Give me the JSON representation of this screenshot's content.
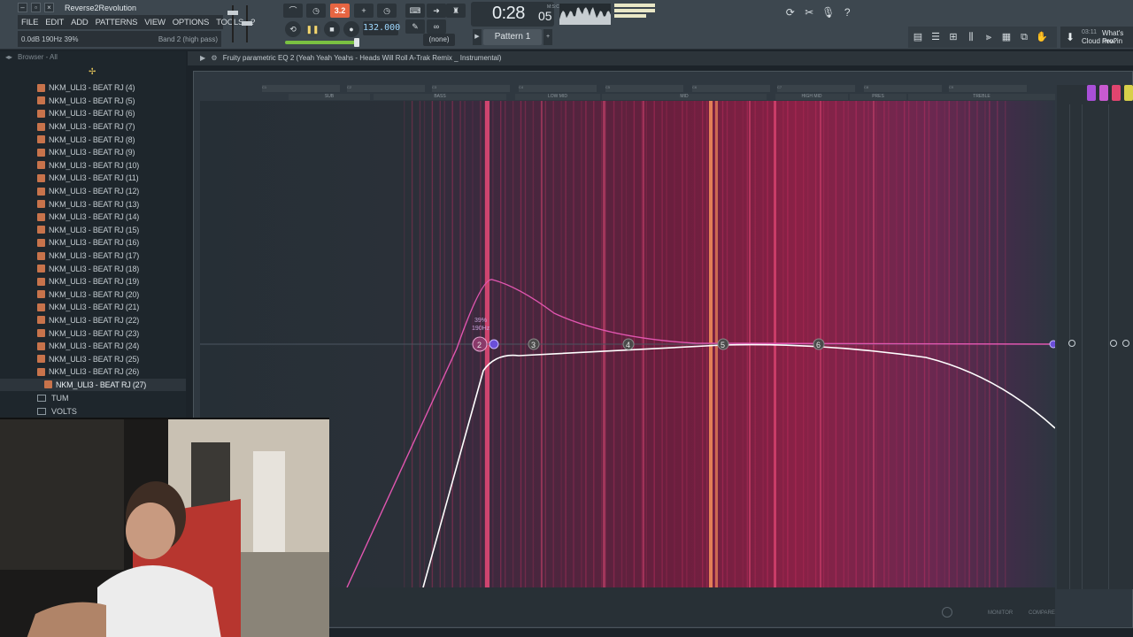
{
  "window": {
    "title": "Reverse2Revolution",
    "menu": [
      "FILE",
      "EDIT",
      "ADD",
      "PATTERNS",
      "VIEW",
      "OPTIONS",
      "TOOLS",
      "?"
    ],
    "hint_left": "0.0dB  190Hz  39%",
    "hint_right": "Band 2 (high pass)"
  },
  "transport": {
    "countdown_label": "3.2",
    "tempo": "132.000",
    "time": "0:28",
    "time_frames": "05",
    "time_unit_label": "M:S:CS",
    "pattern": "Pattern 1",
    "snap": "(none)"
  },
  "news": {
    "date": "03:11",
    "headline": "What's new in",
    "text": "Cloud Pro?"
  },
  "browser": {
    "header": "Browser - All",
    "items": [
      "NKM_ULI3 - BEAT RJ (4)",
      "NKM_ULI3 - BEAT RJ (5)",
      "NKM_ULI3 - BEAT RJ (6)",
      "NKM_ULI3 - BEAT RJ (7)",
      "NKM_ULI3 - BEAT RJ (8)",
      "NKM_ULI3 - BEAT RJ (9)",
      "NKM_ULI3 - BEAT RJ (10)",
      "NKM_ULI3 - BEAT RJ (11)",
      "NKM_ULI3 - BEAT RJ (12)",
      "NKM_ULI3 - BEAT RJ (13)",
      "NKM_ULI3 - BEAT RJ (14)",
      "NKM_ULI3 - BEAT RJ (15)",
      "NKM_ULI3 - BEAT RJ (16)",
      "NKM_ULI3 - BEAT RJ (17)",
      "NKM_ULI3 - BEAT RJ (18)",
      "NKM_ULI3 - BEAT RJ (19)",
      "NKM_ULI3 - BEAT RJ (20)",
      "NKM_ULI3 - BEAT RJ (21)",
      "NKM_ULI3 - BEAT RJ (22)",
      "NKM_ULI3 - BEAT RJ (23)",
      "NKM_ULI3 - BEAT RJ (24)",
      "NKM_ULI3 - BEAT RJ (25)",
      "NKM_ULI3 - BEAT RJ (26)"
    ],
    "selected": "NKM_ULI3 - BEAT RJ (27)",
    "folders": [
      "TUM",
      "VOLTS"
    ]
  },
  "plugin": {
    "title": "Fruity parametric EQ 2 (Yeah Yeah Yeahs - Heads Will Roll A-Trak Remix _ Instrumental)",
    "band_names": [
      "SUB",
      "BASS",
      "LOW MID",
      "MID",
      "HIGH MID",
      "PRES",
      "TREBLE"
    ],
    "octaves": [
      "C1",
      "C2",
      "C3",
      "C4",
      "C5",
      "C6",
      "C7",
      "C8",
      "C9"
    ],
    "selected_band_readout": {
      "width": "39%",
      "freq": "190Hz"
    },
    "nodes": [
      "2",
      "3",
      "4",
      "5",
      "6"
    ],
    "footer_labels": {
      "monitor": "MONITOR",
      "compare": "COMPARE"
    },
    "colors": {
      "spectrum": "#e0336b",
      "curve_pink": "#e056b0",
      "curve_white": "#ffffff",
      "band_swatches": [
        "#a94fd8",
        "#c85ad0",
        "#e0456f",
        "#d8d04a"
      ]
    }
  }
}
